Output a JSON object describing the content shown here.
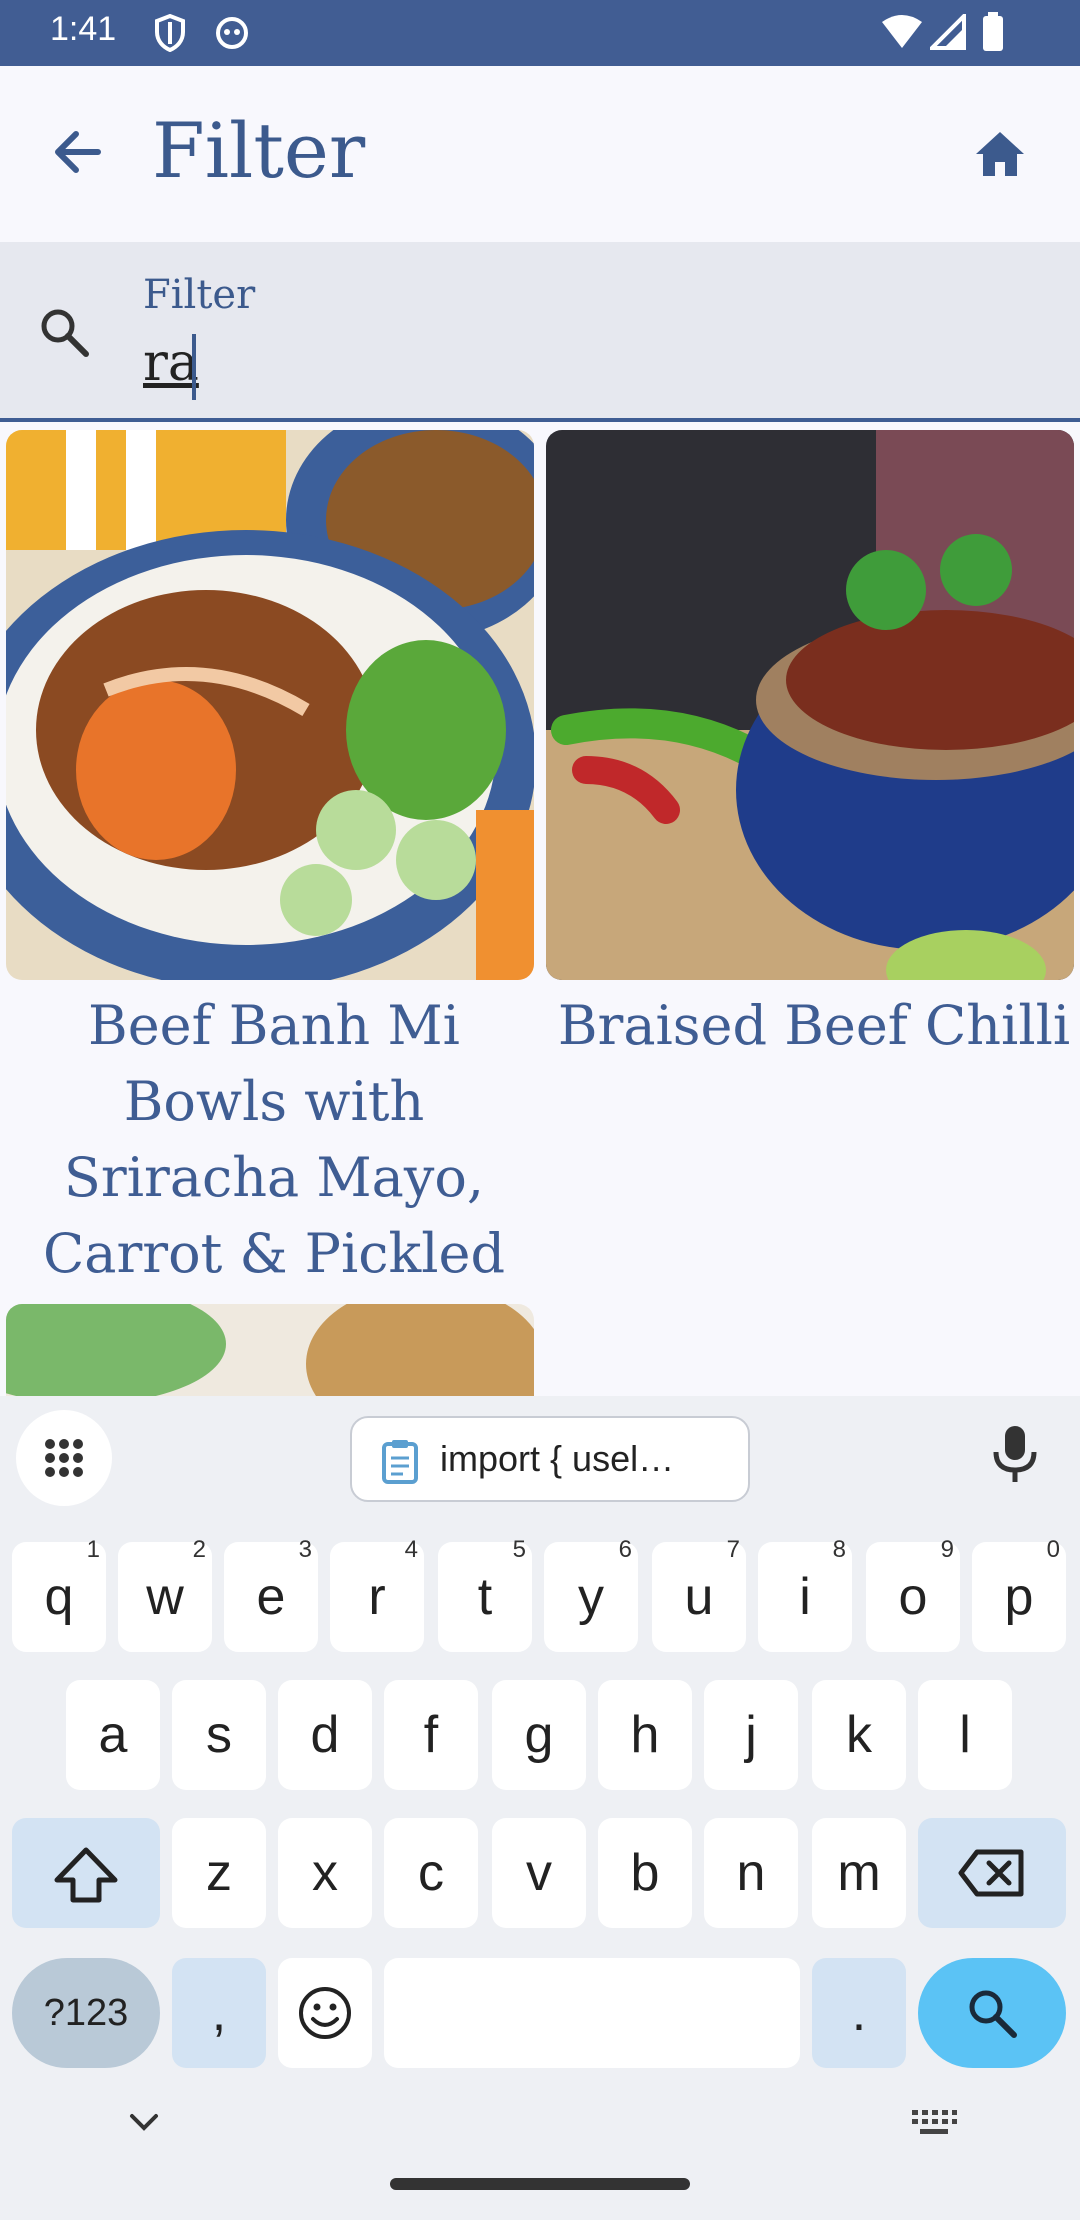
{
  "status_bar": {
    "time": "1:41"
  },
  "app_bar": {
    "title": "Filter"
  },
  "filter": {
    "label": "Filter",
    "value": "ra"
  },
  "recipes": [
    {
      "name": "Beef Banh Mi Bowls with Sriracha Mayo, Carrot & Pickled Cucumber"
    },
    {
      "name": "Braised Beef Chilli"
    }
  ],
  "keyboard": {
    "clipboard_preview": "import { usel…",
    "row1": [
      "q",
      "w",
      "e",
      "r",
      "t",
      "y",
      "u",
      "i",
      "o",
      "p"
    ],
    "row1_digits": [
      "1",
      "2",
      "3",
      "4",
      "5",
      "6",
      "7",
      "8",
      "9",
      "0"
    ],
    "row2": [
      "a",
      "s",
      "d",
      "f",
      "g",
      "h",
      "j",
      "k",
      "l"
    ],
    "row3": [
      "z",
      "x",
      "c",
      "v",
      "b",
      "n",
      "m"
    ],
    "symbols_label": "?123",
    "comma_label": ",",
    "period_label": "."
  },
  "colors": {
    "accent": "#3f5d93",
    "status_bar": "#415d93",
    "search_key": "#5bc3f5"
  }
}
